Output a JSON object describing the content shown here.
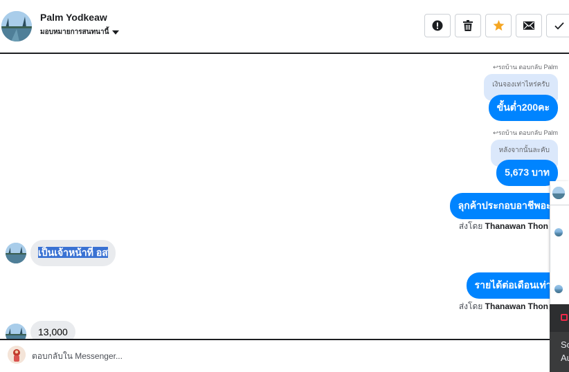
{
  "header": {
    "contact_name": "Palm Yodkeaw",
    "assign_label": "มอบหมายการสนทนานี้",
    "actions": [
      {
        "name": "spam-button",
        "icon": "alert-circle-icon"
      },
      {
        "name": "delete-button",
        "icon": "trash-icon"
      },
      {
        "name": "star-button",
        "icon": "star-icon",
        "color": "#f5a623"
      },
      {
        "name": "mark-unread-button",
        "icon": "envelope-icon"
      },
      {
        "name": "done-button",
        "icon": "check-icon"
      }
    ]
  },
  "thread": {
    "messages": [
      {
        "type": "reply-context",
        "text": "↩รถบ้าน ตอบกลับ Palm"
      },
      {
        "type": "quoted",
        "text": "เงินจองเท่าไหร่ครับ"
      },
      {
        "type": "outgoing",
        "text": "ขั้นต่ำ200คะ"
      },
      {
        "type": "reply-context",
        "text": "↩รถบ้าน ตอบกลับ Palm"
      },
      {
        "type": "quoted",
        "text": "หลังจากนั้นละคับ"
      },
      {
        "type": "outgoing",
        "text": "5,673 บาท"
      },
      {
        "type": "outgoing",
        "text": "ลุกค้าประกอบอาชีพอะไรคะ"
      },
      {
        "type": "sent-by",
        "prefix": "ส่งโดย",
        "sender": "Thanawan Thon"
      },
      {
        "type": "incoming",
        "text": "เป็นเจ้าหน้าที่ อส"
      },
      {
        "type": "outgoing",
        "text": "รายได้ต่อเดือนเท่าไรคะ"
      },
      {
        "type": "sent-by",
        "prefix": "ส่งโดย",
        "sender": "Thanawan Thon"
      },
      {
        "type": "incoming",
        "text": "13,000"
      }
    ]
  },
  "side_panel": {
    "text_line1": "So",
    "text_line2": "Au"
  },
  "composer": {
    "placeholder": "ตอบกลับใน Messenger..."
  },
  "colors": {
    "brand_blue": "#0084ff",
    "quoted_bg": "#dbe8fb",
    "incoming_bg": "#e9ebee",
    "star": "#f5a623"
  }
}
